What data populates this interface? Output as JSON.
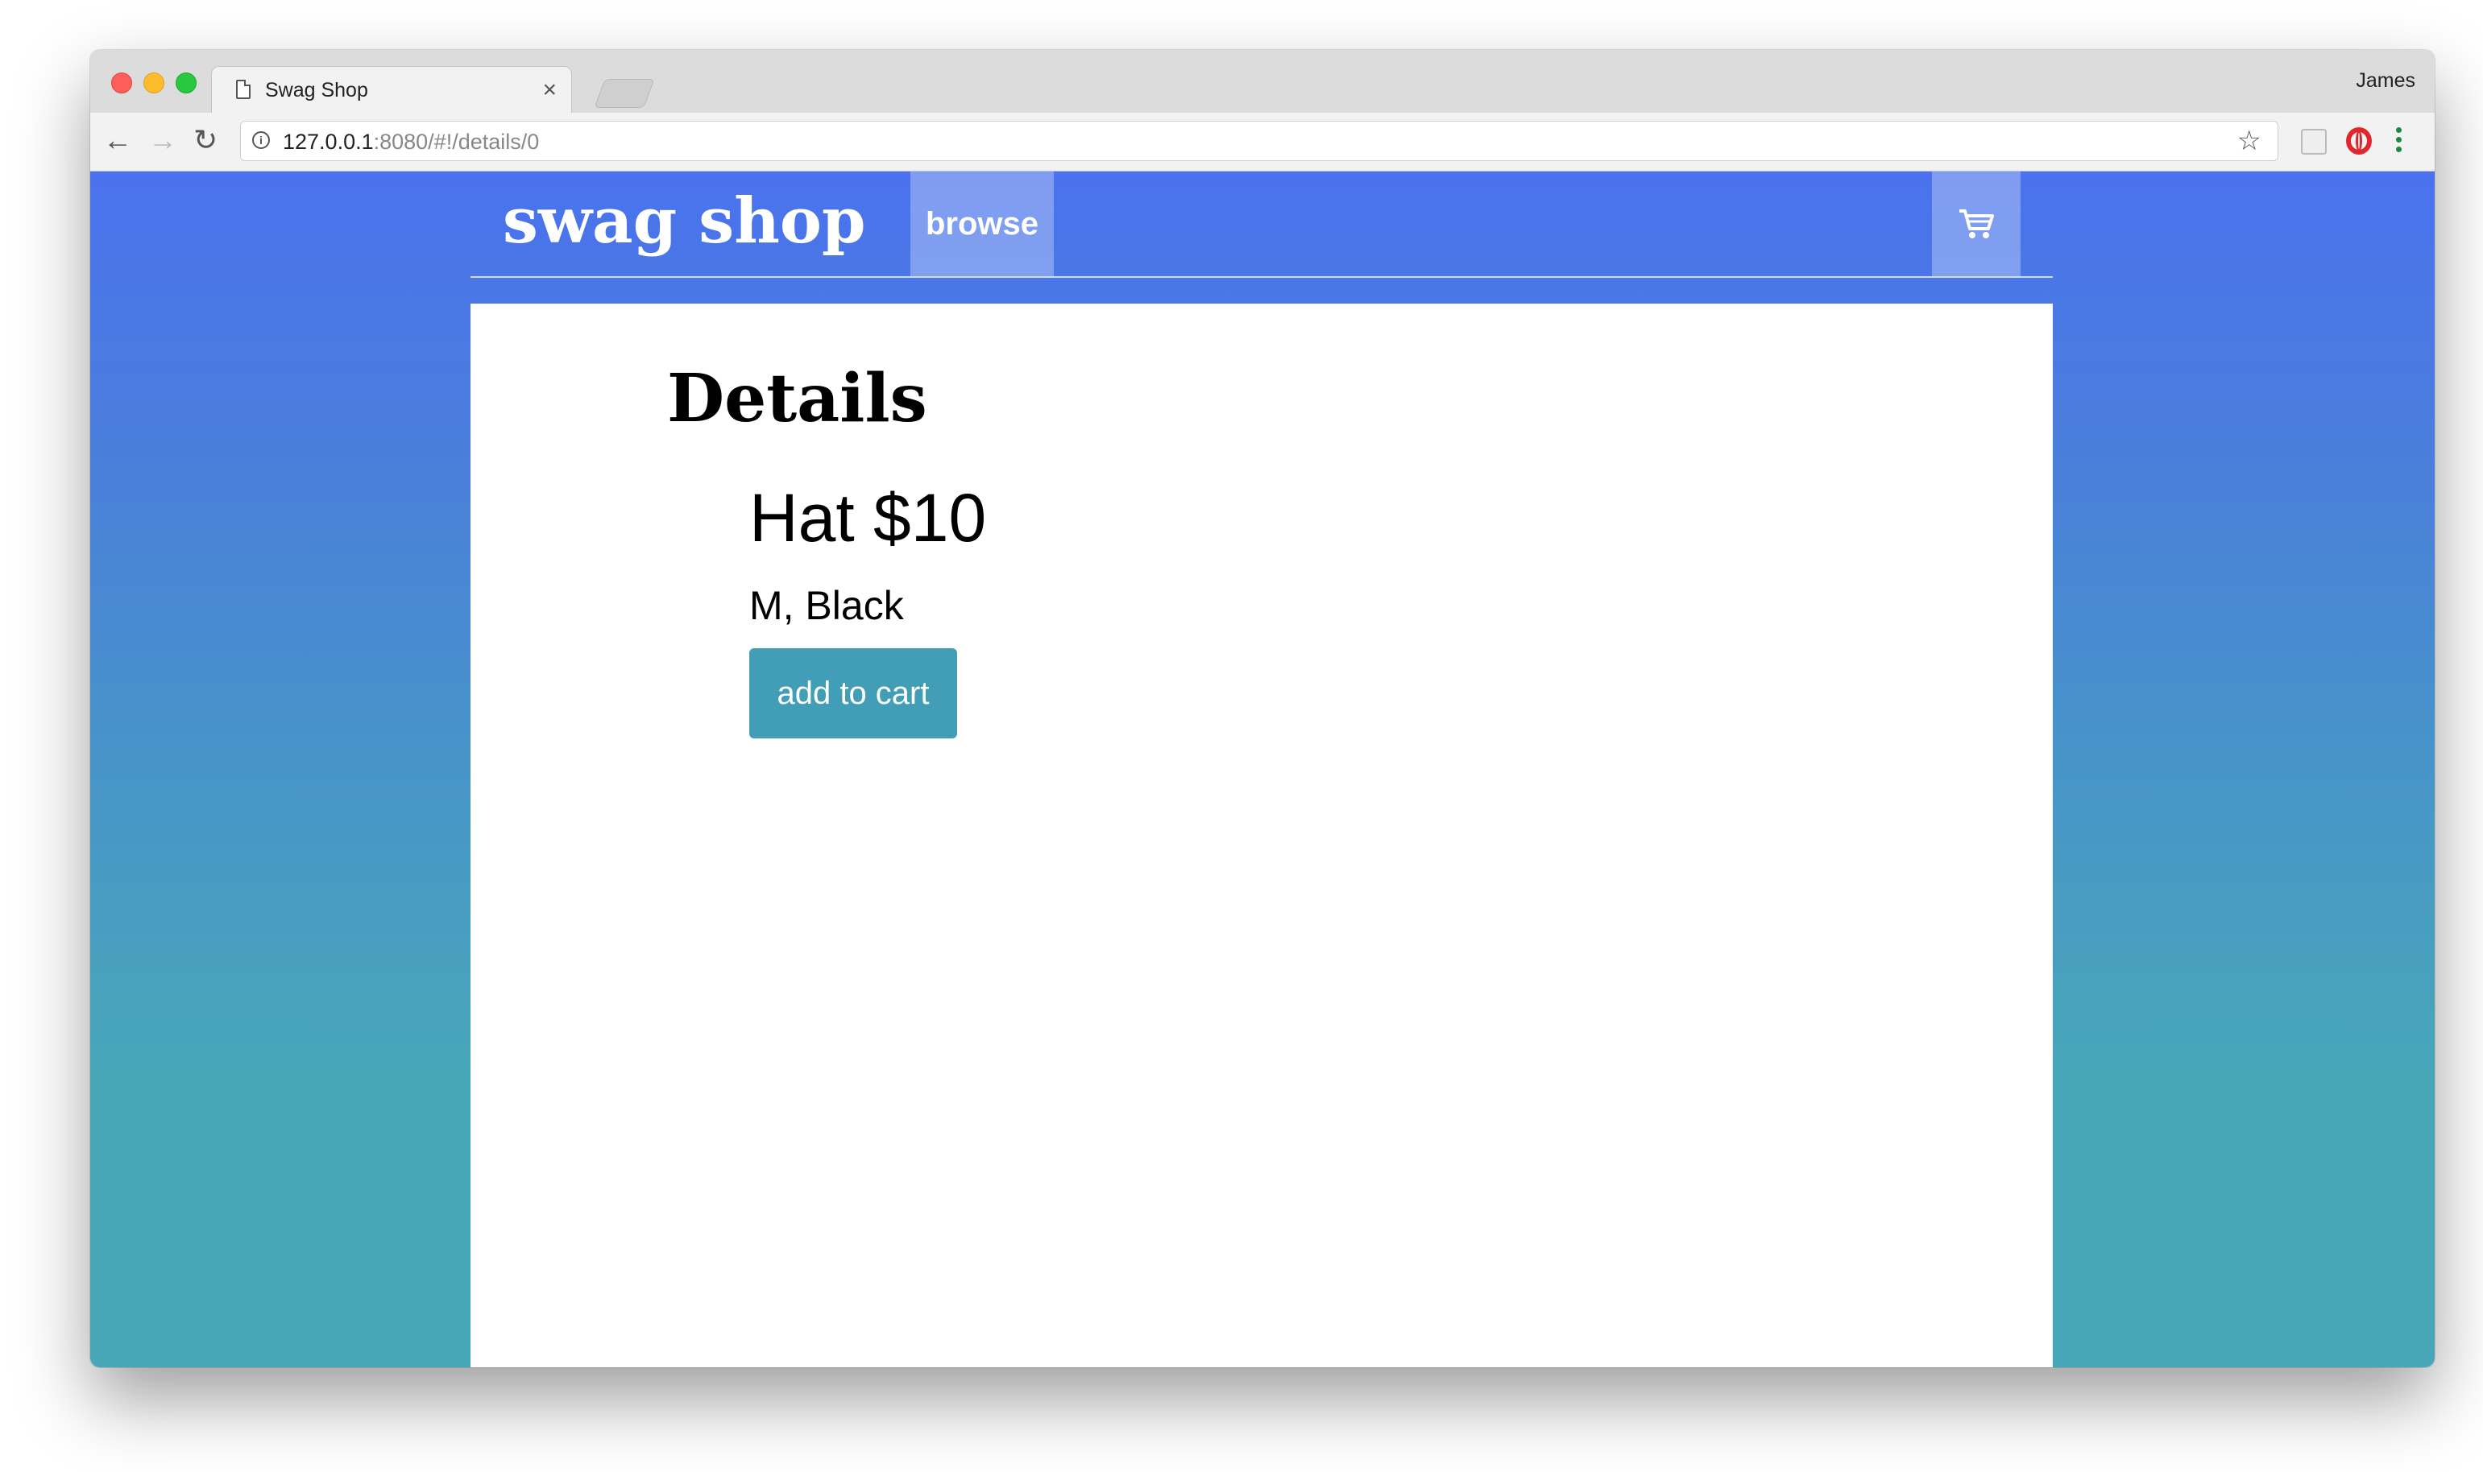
{
  "browser": {
    "tab_title": "Swag Shop",
    "tab_close": "×",
    "profile_name": "James",
    "url_host": "127.0.0.1",
    "url_rest": ":8080/#!/details/0"
  },
  "site": {
    "brand": "swag shop",
    "nav_browse": "browse",
    "cart_icon": "cart-icon"
  },
  "details": {
    "heading": "Details",
    "product_title": "Hat $10",
    "variant": "M, Black",
    "add_to_cart": "add to cart"
  },
  "colors": {
    "gradient_top": "#4a72ee",
    "gradient_bottom": "#48a6b9",
    "button": "#419eb6"
  }
}
